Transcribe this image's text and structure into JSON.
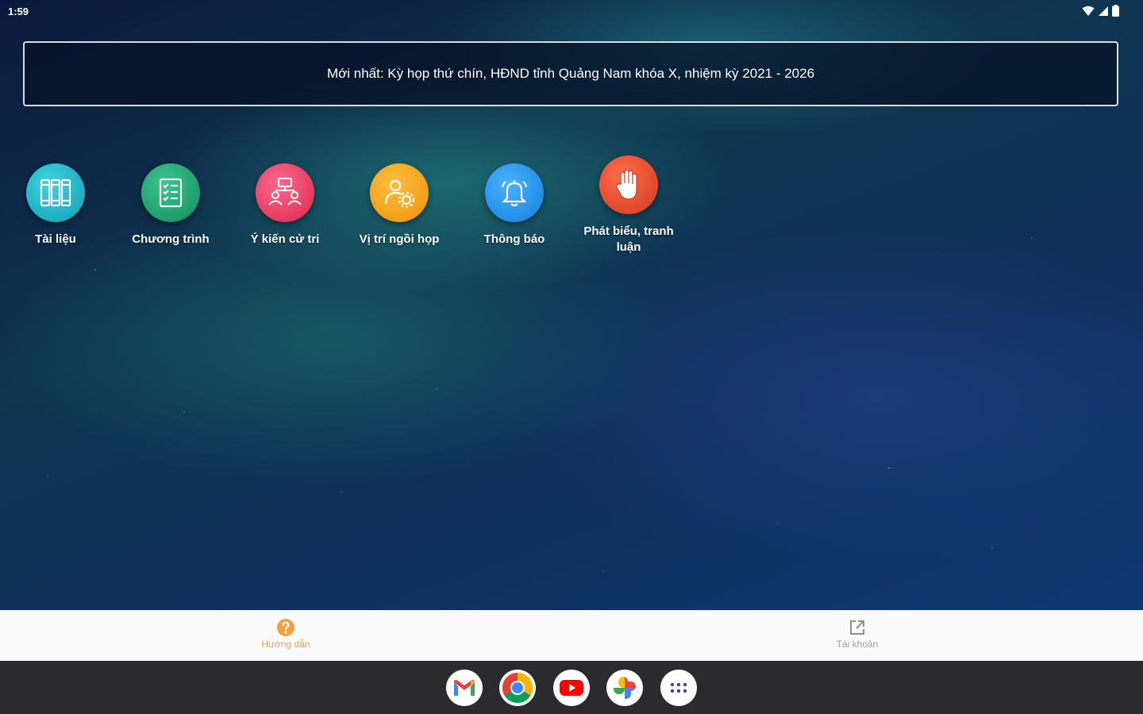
{
  "status_bar": {
    "time": "1:59",
    "icons": [
      "wifi-icon",
      "signal-icon",
      "battery-icon"
    ]
  },
  "banner": {
    "text": "Mới nhất: Kỳ họp thứ chín, HĐND tỉnh Quảng Nam khóa X, nhiệm kỳ 2021 - 2026"
  },
  "apps": [
    {
      "label": "Tài liệu",
      "icon": "books-icon",
      "color": "#1ab6c8"
    },
    {
      "label": "Chương trình",
      "icon": "checklist-icon",
      "color": "#1aa06e"
    },
    {
      "label": "Ý kiến cử tri",
      "icon": "people-network-icon",
      "color": "#ec3f6a"
    },
    {
      "label": "Vị trí ngồi họp",
      "icon": "person-gear-icon",
      "color": "#f7a21b"
    },
    {
      "label": "Thông báo",
      "icon": "bell-icon",
      "color": "#1e93ea"
    },
    {
      "label": "Phát biểu, tranh luận",
      "icon": "raised-hand-icon",
      "color": "#e2462a"
    }
  ],
  "bottom_nav": {
    "help_label": "Hướng dẫn",
    "account_label": "Tài khoản",
    "active_color": "#f5a040",
    "inactive_color": "#9aa0a6"
  },
  "dock": [
    "gmail-icon",
    "chrome-icon",
    "youtube-icon",
    "photos-icon",
    "app-drawer-icon"
  ]
}
